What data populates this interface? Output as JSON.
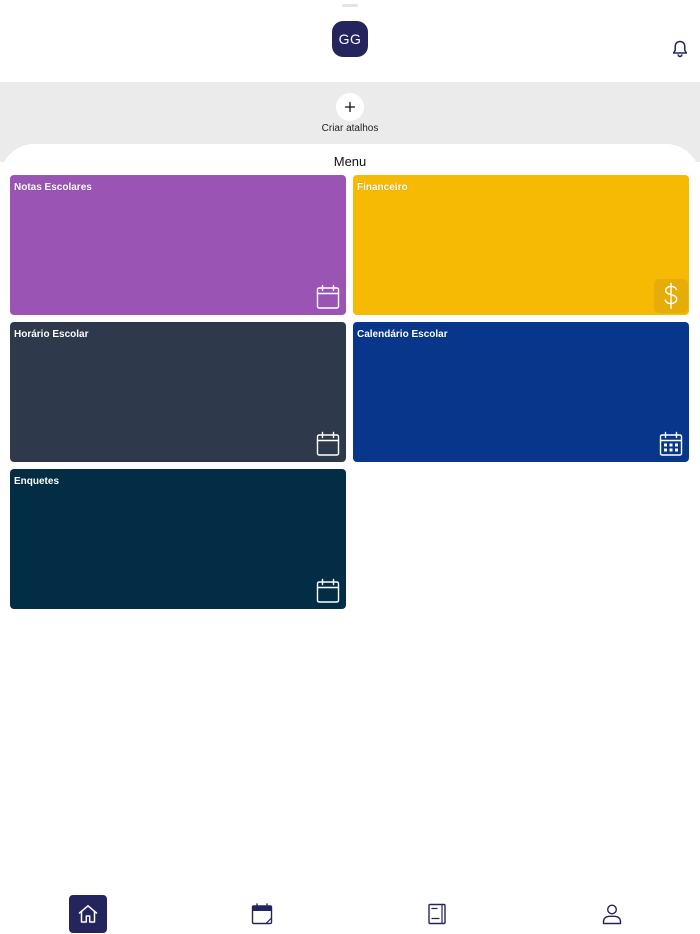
{
  "header": {
    "avatar_initials": "GG",
    "notification_icon": "bell-icon"
  },
  "shortcuts": {
    "add_label": "Criar atalhos",
    "add_icon": "plus-icon"
  },
  "menu": {
    "title": "Menu",
    "cards": [
      {
        "label": "Notas Escolares",
        "color": "#9a55b4",
        "icon": "calendar-icon"
      },
      {
        "label": "Financeiro",
        "color": "#f6b904",
        "icon": "dollar-icon",
        "icon_bg": "#e6ac07"
      },
      {
        "label": "Horário Escolar",
        "color": "#2e3a4b",
        "icon": "calendar-icon"
      },
      {
        "label": "Calendário Escolar",
        "color": "#07368a",
        "icon": "calendar-grid-icon"
      },
      {
        "label": "Enquetes",
        "color": "#032d45",
        "icon": "calendar-icon"
      }
    ]
  },
  "tabbar": {
    "active_color": "#25255e",
    "tabs": [
      {
        "name": "home",
        "icon": "home-icon",
        "active": true
      },
      {
        "name": "agenda",
        "icon": "calendar-icon",
        "active": false
      },
      {
        "name": "book",
        "icon": "book-icon",
        "active": false
      },
      {
        "name": "profile",
        "icon": "user-icon",
        "active": false
      }
    ]
  }
}
